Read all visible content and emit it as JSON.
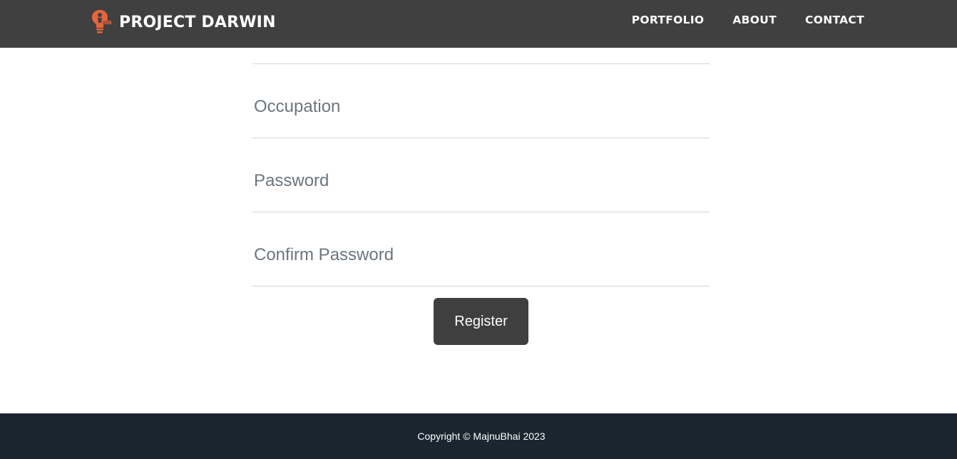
{
  "navbar": {
    "brand": {
      "title": "PROJECT DARWIN",
      "logo_icon": "lightbulb-person-icon",
      "logo_color": "#e8643a"
    },
    "links": [
      {
        "label": "PORTFOLIO"
      },
      {
        "label": "ABOUT"
      },
      {
        "label": "CONTACT"
      }
    ],
    "background": "#404040"
  },
  "form": {
    "fields": [
      {
        "placeholder": "Occupation",
        "value": ""
      },
      {
        "placeholder": "Password",
        "value": ""
      },
      {
        "placeholder": "Confirm Password",
        "value": ""
      }
    ],
    "submit_label": "Register",
    "button_color": "#3f3f3f"
  },
  "footer": {
    "text": "Copyright © MajnuBhai 2023",
    "background": "#1b2530"
  }
}
